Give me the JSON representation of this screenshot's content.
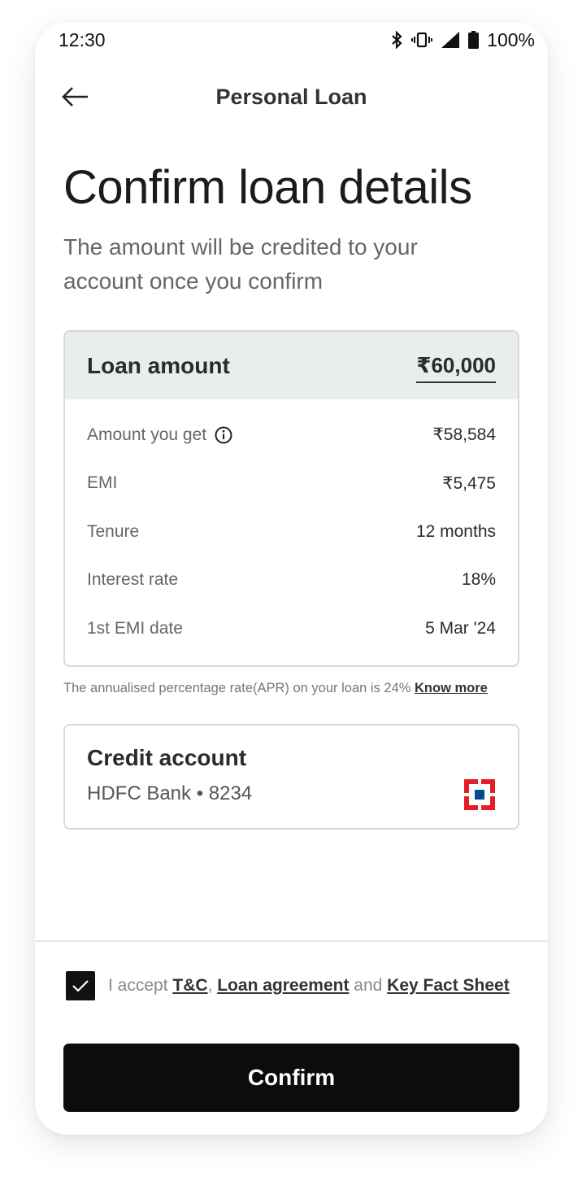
{
  "status_bar": {
    "time": "12:30",
    "battery": "100%",
    "icons": [
      "bluetooth-icon",
      "vibrate-icon",
      "signal-icon",
      "battery-icon"
    ]
  },
  "app_bar": {
    "title": "Personal Loan",
    "back_icon": "arrow-left-icon"
  },
  "heading": {
    "title": "Confirm loan details",
    "subtitle": "The amount will be credited to your account once you confirm"
  },
  "loan_summary": {
    "header_label": "Loan amount",
    "header_value": "₹60,000",
    "rows": [
      {
        "label": "Amount you get",
        "value": "₹58,584",
        "info_icon": "info-icon"
      },
      {
        "label": "EMI",
        "value": "₹5,475"
      },
      {
        "label": "Tenure",
        "value": "12 months"
      },
      {
        "label": "Interest rate",
        "value": "18%"
      },
      {
        "label": "1st EMI date",
        "value": "5 Mar '24"
      }
    ]
  },
  "apr": {
    "text": "The annualised percentage rate(APR) on your loan is 24% ",
    "link": "Know more"
  },
  "credit_account": {
    "title": "Credit account",
    "bank": "HDFC Bank • 8234",
    "logo_icon": "hdfc-logo-icon"
  },
  "consent": {
    "checked": true,
    "prefix": "I accept ",
    "tc": "T&C",
    "sep": ", ",
    "loan_agreement": "Loan agreement",
    "and": " and ",
    "kfs": "Key Fact Sheet"
  },
  "confirm_label": "Confirm",
  "colors": {
    "primary": "#0c0c0c",
    "card_header_bg": "#e8eeee",
    "hdfc_red": "#e41e26",
    "hdfc_blue": "#004c8f"
  }
}
